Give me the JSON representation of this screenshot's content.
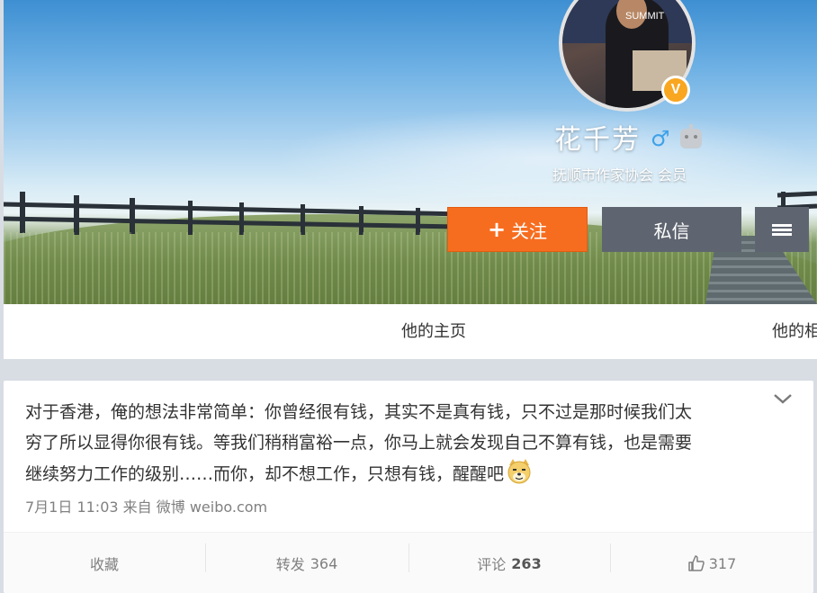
{
  "profile": {
    "name": "花千芳",
    "description": "抚顺市作家协会 会员",
    "avatar_text": "SUMMIT",
    "verified_badge": "V"
  },
  "actions": {
    "follow_label": "关注",
    "message_label": "私信"
  },
  "nav": {
    "tabs": [
      {
        "label": "他的主页"
      },
      {
        "label": "他的相册"
      }
    ]
  },
  "post": {
    "lines": [
      "对于香港，俺的想法非常简单：你曾经很有钱，其实不是真有钱，只不过是那时候我们太",
      "穷了所以显得你很有钱。等我们稍稍富裕一点，你马上就会发现自己不算有钱，也是需要",
      "继续努力工作的级别……而你，却不想工作，只想有钱，醒醒吧"
    ],
    "meta": "7月1日 11:03 来自 微博 weibo.com",
    "favorite_label": "收藏",
    "repost_label": "转发",
    "repost_count": "364",
    "comment_label": "评论",
    "comment_count": "263",
    "like_count": "317"
  },
  "colors": {
    "follow": "#f76d20",
    "secondary_button": "#5f6570",
    "verified": "#f9a620",
    "gender": "#3ea1e8"
  },
  "icons": [
    "plus-icon",
    "menu-icon",
    "verified-icon",
    "male-icon",
    "robot-icon",
    "chevron-down-icon",
    "doge-emoji",
    "thumbs-up-icon"
  ]
}
